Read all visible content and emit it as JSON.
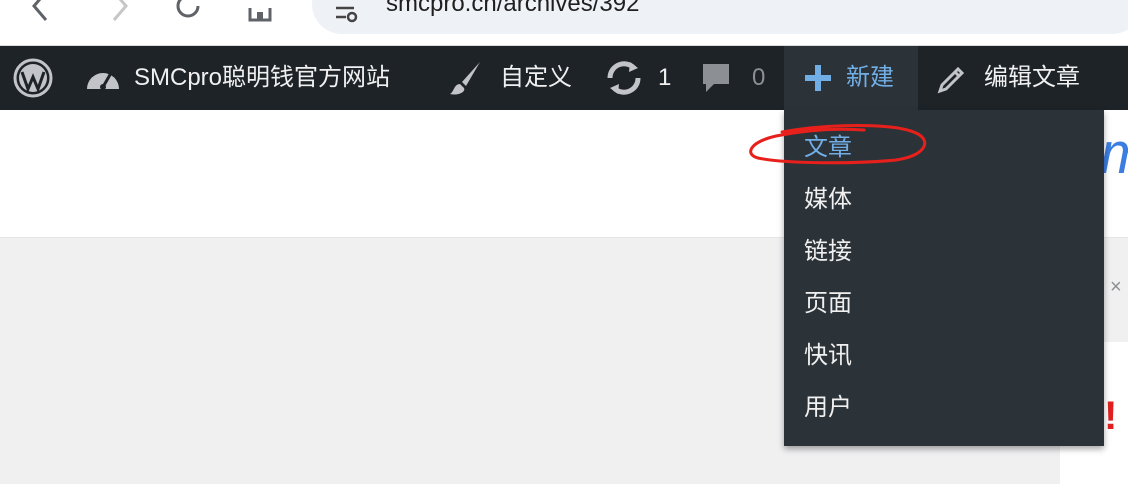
{
  "browser": {
    "url": "smcpro.cn/archives/392"
  },
  "adminbar": {
    "site_name": "SMCpro聪明钱官方网站",
    "customize": "自定义",
    "updates_count": "1",
    "comments_count": "0",
    "new_label": "新建",
    "edit_label": "编辑文章"
  },
  "new_menu": {
    "items": [
      "文章",
      "媒体",
      "链接",
      "页面",
      "快讯",
      "用户"
    ],
    "highlighted": "文章"
  },
  "page": {
    "logo_fragment": "m",
    "side_mark": "!",
    "side_close": "×"
  },
  "colors": {
    "adminbar_bg": "#1d2327",
    "submenu_bg": "#2c3338",
    "accent": "#72aee6",
    "annotation": "#e8201c"
  },
  "icons": [
    "back-icon",
    "forward-icon",
    "reload-icon",
    "home-icon",
    "site-info-icon",
    "wordpress-icon",
    "dashboard-icon",
    "brush-icon",
    "updates-icon",
    "comment-icon",
    "plus-icon",
    "pencil-icon"
  ]
}
